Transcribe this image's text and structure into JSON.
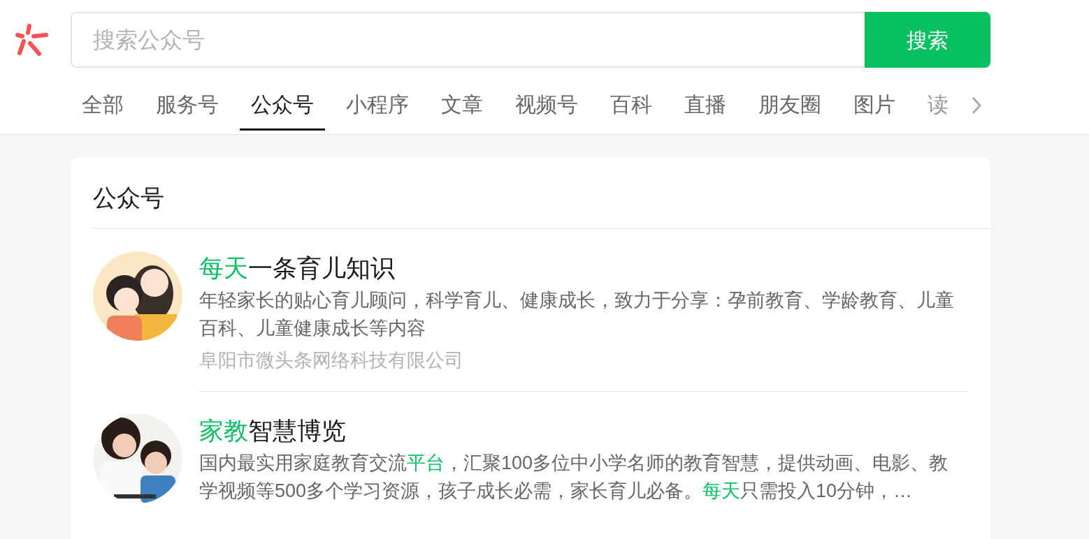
{
  "search": {
    "placeholder": "搜索公众号",
    "button": "搜索"
  },
  "tabs": [
    {
      "label": "全部",
      "selected": false
    },
    {
      "label": "服务号",
      "selected": false
    },
    {
      "label": "公众号",
      "selected": true
    },
    {
      "label": "小程序",
      "selected": false
    },
    {
      "label": "文章",
      "selected": false
    },
    {
      "label": "视频号",
      "selected": false
    },
    {
      "label": "百科",
      "selected": false
    },
    {
      "label": "直播",
      "selected": false
    },
    {
      "label": "朋友圈",
      "selected": false
    },
    {
      "label": "图片",
      "selected": false
    },
    {
      "label": "读",
      "selected": false
    }
  ],
  "section": {
    "title": "公众号"
  },
  "accounts": [
    {
      "kind": "picture",
      "title": [
        {
          "text": "每天",
          "highlight": true
        },
        {
          "text": "一条育儿知识",
          "highlight": false
        }
      ],
      "description": [
        {
          "text": "年轻家长的贴心育儿顾问，科学育儿、健康成长，致力于分享：孕前教育、学龄教育、儿童百科、儿童健康成长等内容",
          "highlight": false
        }
      ],
      "company": "阜阳市微头条网络科技有限公司"
    },
    {
      "kind": "picture",
      "title": [
        {
          "text": "家教",
          "highlight": true
        },
        {
          "text": "智慧博览",
          "highlight": false
        }
      ],
      "description": [
        {
          "text": "国内最实用家庭教育交流",
          "highlight": false
        },
        {
          "text": "平台",
          "highlight": true
        },
        {
          "text": "，汇聚100多位中小学名师的教育智慧，提供动画、电影、教学视频等500多个学习资源，孩子成长必需，家长育儿必备。",
          "highlight": false
        },
        {
          "text": "每天",
          "highlight": true
        },
        {
          "text": "只需投入10分钟，…",
          "highlight": false
        }
      ]
    }
  ]
}
